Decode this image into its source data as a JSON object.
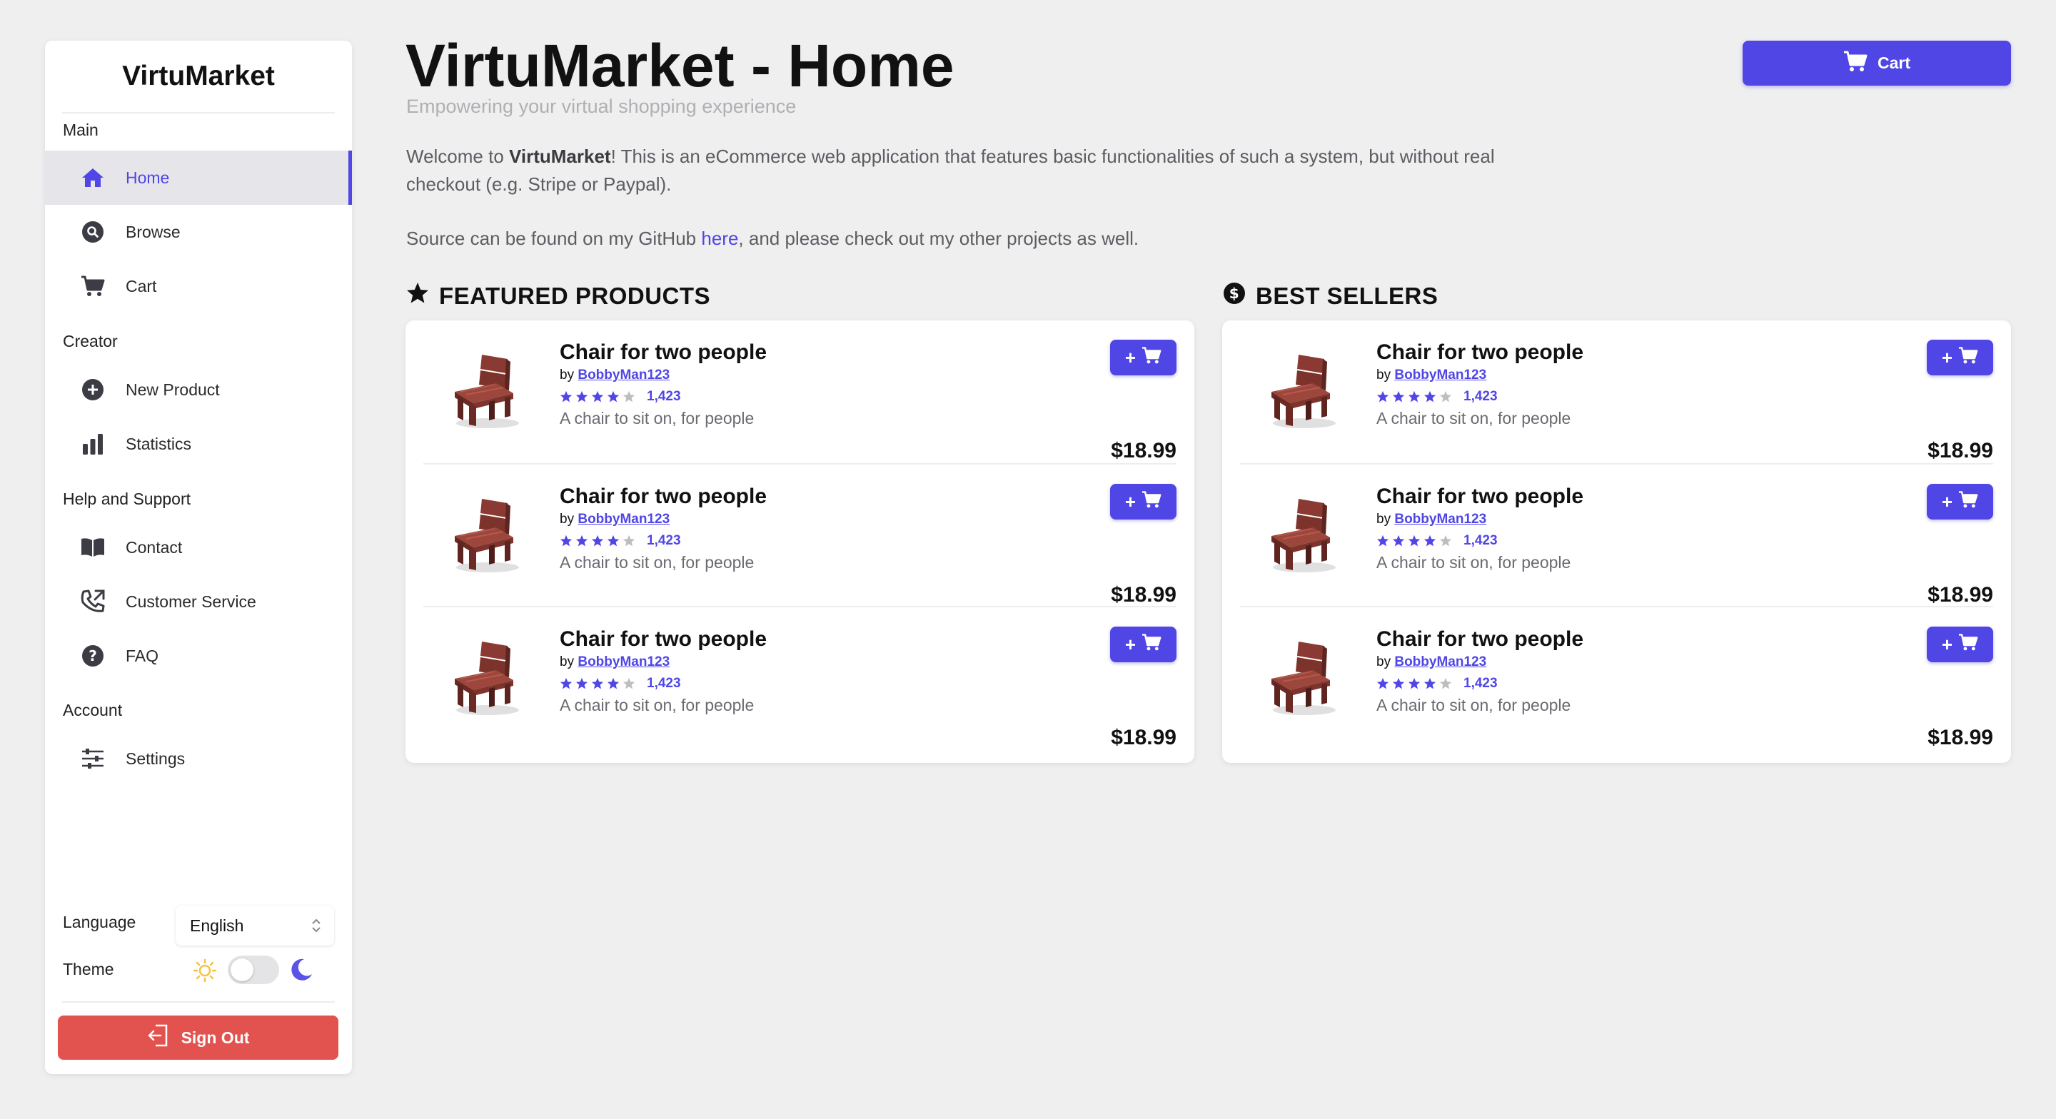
{
  "app": {
    "brand": "VirtuMarket"
  },
  "sidebar": {
    "sections": {
      "main": "Main",
      "creator": "Creator",
      "help": "Help and Support",
      "account": "Account"
    },
    "items": {
      "home": "Home",
      "browse": "Browse",
      "cart": "Cart",
      "new_product": "New Product",
      "statistics": "Statistics",
      "contact": "Contact",
      "customer_service": "Customer Service",
      "faq": "FAQ",
      "settings": "Settings"
    },
    "active": "home",
    "language_label": "Language",
    "language_value": "English",
    "theme_label": "Theme",
    "theme_dark": false,
    "sign_out": "Sign Out"
  },
  "header": {
    "title": "VirtuMarket - Home",
    "subtitle": "Empowering your virtual shopping experience",
    "cart_button": "Cart"
  },
  "intro": {
    "p1_pre": "Welcome to ",
    "p1_bold": "VirtuMarket",
    "p1_post": "! This is an eCommerce web application that features basic functionalities of such a system, but without real checkout (e.g. Stripe or Paypal).",
    "p2_pre": "Source can be found on my GitHub ",
    "p2_link": "here",
    "p2_post": ", and please check out my other projects as well."
  },
  "featured": {
    "heading": "FEATURED PRODUCTS",
    "products": [
      {
        "name": "Chair for two people",
        "by": "by",
        "author": "BobbyMan123",
        "stars": 4,
        "reviews": "1,423",
        "description": "A chair to sit on, for people",
        "price": "$18.99",
        "add_label": "+"
      },
      {
        "name": "Chair for two people",
        "by": "by",
        "author": "BobbyMan123",
        "stars": 4,
        "reviews": "1,423",
        "description": "A chair to sit on, for people",
        "price": "$18.99",
        "add_label": "+"
      },
      {
        "name": "Chair for two people",
        "by": "by",
        "author": "BobbyMan123",
        "stars": 4,
        "reviews": "1,423",
        "description": "A chair to sit on, for people",
        "price": "$18.99",
        "add_label": "+"
      }
    ]
  },
  "best": {
    "heading": "BEST SELLERS",
    "products": [
      {
        "name": "Chair for two people",
        "by": "by",
        "author": "BobbyMan123",
        "stars": 4,
        "reviews": "1,423",
        "description": "A chair to sit on, for people",
        "price": "$18.99",
        "add_label": "+"
      },
      {
        "name": "Chair for two people",
        "by": "by",
        "author": "BobbyMan123",
        "stars": 4,
        "reviews": "1,423",
        "description": "A chair to sit on, for people",
        "price": "$18.99",
        "add_label": "+"
      },
      {
        "name": "Chair for two people",
        "by": "by",
        "author": "BobbyMan123",
        "stars": 4,
        "reviews": "1,423",
        "description": "A chair to sit on, for people",
        "price": "$18.99",
        "add_label": "+"
      }
    ]
  },
  "colors": {
    "accent": "#4f46e5",
    "danger": "#e2524f",
    "background": "#efeff0",
    "star_filled": "#4f46e5",
    "star_empty": "#bdbdc2"
  },
  "icons": {
    "home": "home-icon",
    "browse": "search-icon",
    "cart": "cart-icon",
    "new_product": "plus-circle-icon",
    "statistics": "bar-chart-icon",
    "contact": "book-icon",
    "customer_service": "phone-icon",
    "faq": "question-icon",
    "settings": "sliders-icon",
    "featured": "star-icon",
    "best": "dollar-icon",
    "sign_out": "logout-icon",
    "theme_light": "sun-icon",
    "theme_dark": "moon-icon"
  }
}
